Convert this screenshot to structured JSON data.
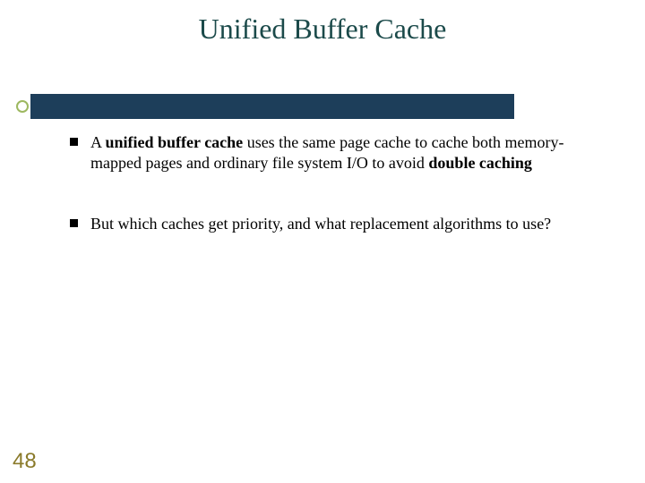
{
  "title": "Unified Buffer Cache",
  "bullets": [
    {
      "prefix": "A ",
      "bold1": "unified buffer cache",
      "mid": " uses the same page cache to cache both memory-mapped pages and ordinary file system I/O to avoid ",
      "bold2": "double caching",
      "suffix": ""
    },
    {
      "prefix": "But which caches get priority, and what replacement algorithms to use?",
      "bold1": "",
      "mid": "",
      "bold2": "",
      "suffix": ""
    }
  ],
  "page_number": "48"
}
